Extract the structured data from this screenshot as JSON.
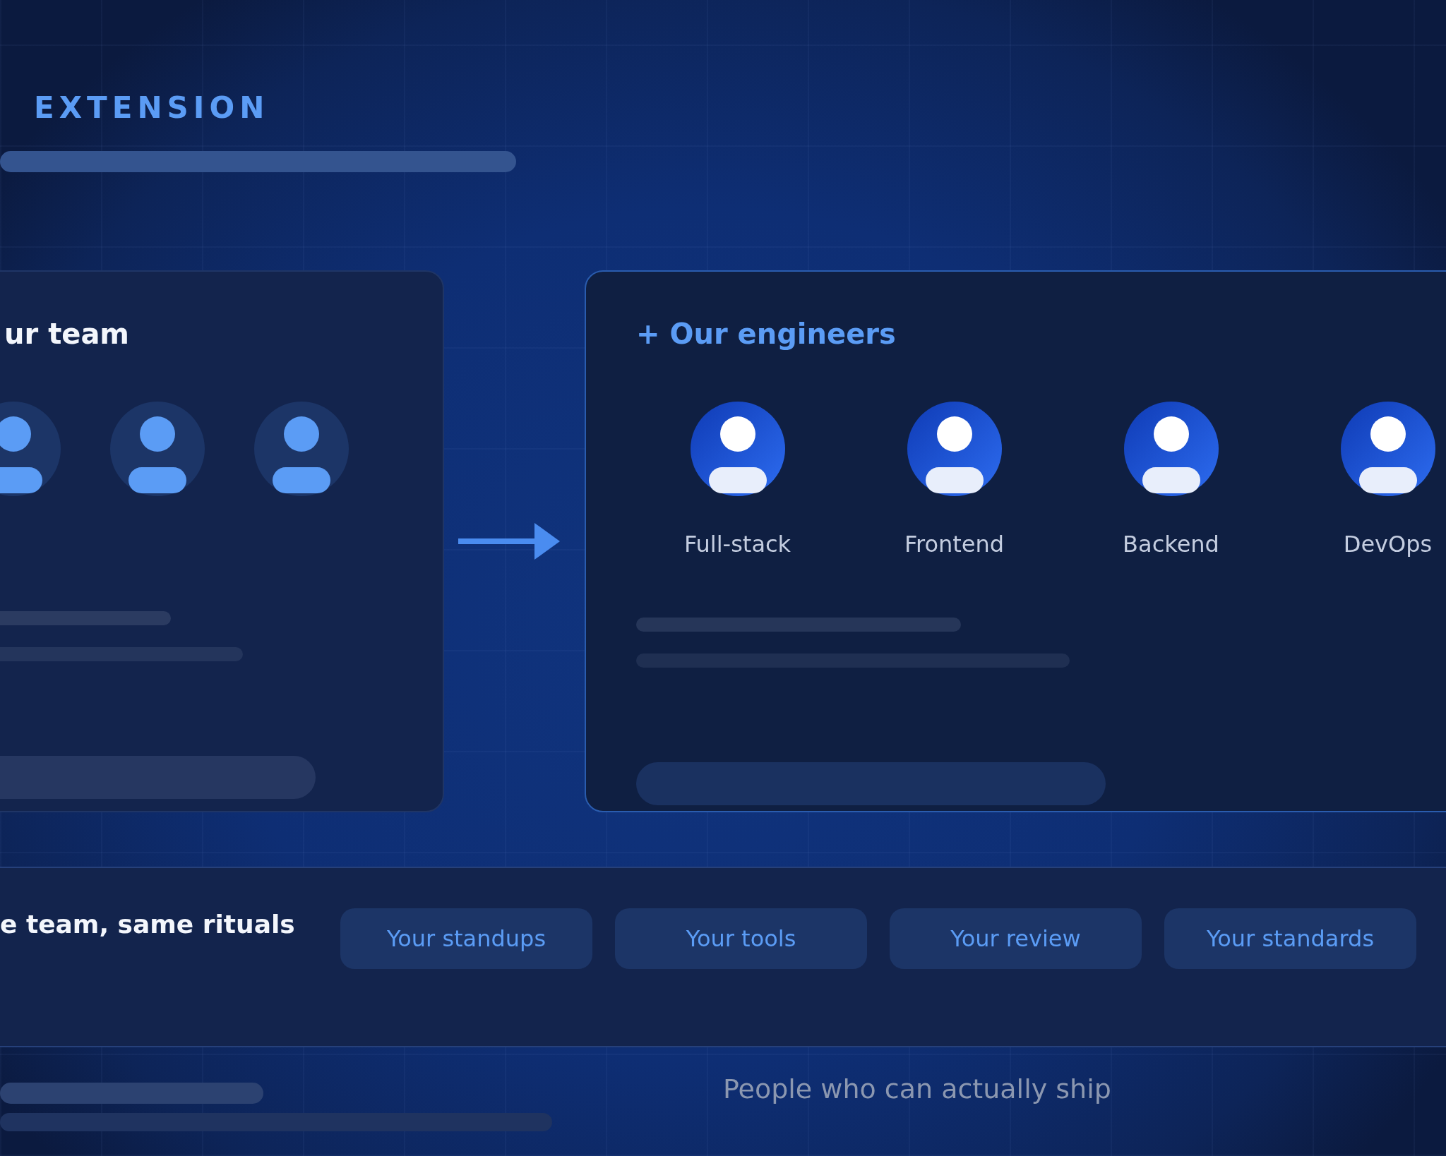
{
  "header": {
    "title": "EXTENSION"
  },
  "team_card": {
    "title": "ur team"
  },
  "engineers_card": {
    "title": "+ Our engineers",
    "roles": [
      {
        "label": "Full-stack"
      },
      {
        "label": "Frontend"
      },
      {
        "label": "Backend"
      },
      {
        "label": "DevOps"
      }
    ]
  },
  "band": {
    "tagline": "e team, same rituals",
    "chips": [
      {
        "label": "Your standups"
      },
      {
        "label": "Your tools"
      },
      {
        "label": "Your review"
      },
      {
        "label": "Your standards"
      }
    ]
  },
  "footer": {
    "caption": "People who can actually ship"
  }
}
